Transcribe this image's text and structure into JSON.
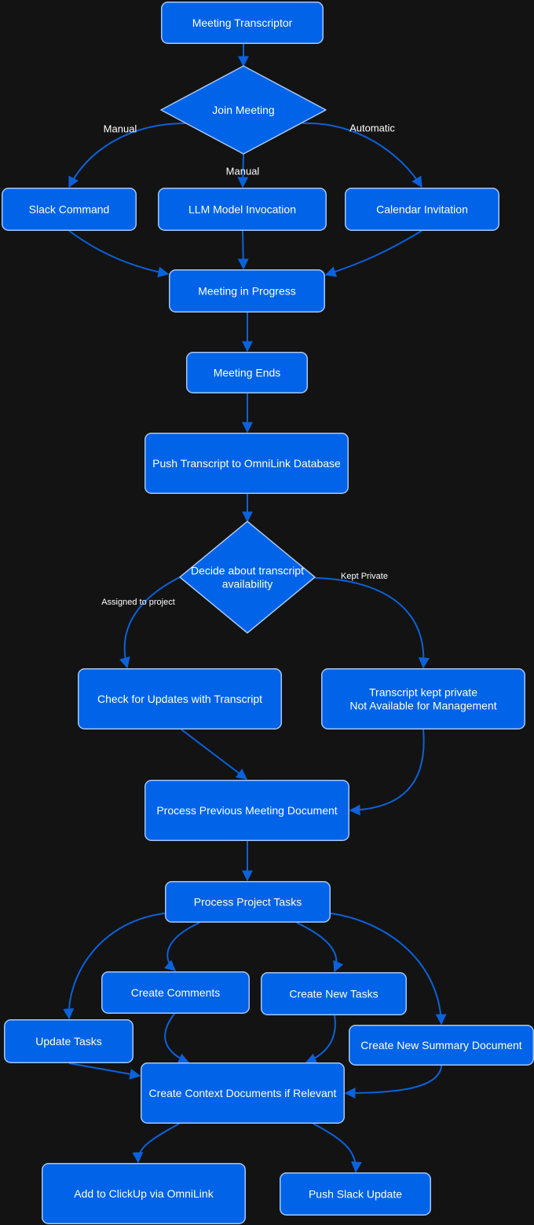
{
  "diagram": {
    "type": "flowchart",
    "colors": {
      "background": "#131313",
      "node_fill": "#0063e8",
      "node_stroke": "#a8c6f2",
      "edge": "#0a62dc",
      "text": "#ffffff"
    },
    "nodes": [
      {
        "id": "meeting_transcriptor",
        "shape": "rect",
        "label": [
          "Meeting Transcriptor"
        ]
      },
      {
        "id": "join_meeting",
        "shape": "diamond",
        "label": [
          "Join Meeting"
        ]
      },
      {
        "id": "slack_command",
        "shape": "rect",
        "label": [
          "Slack Command"
        ]
      },
      {
        "id": "llm_invocation",
        "shape": "rect",
        "label": [
          "LLM Model Invocation"
        ]
      },
      {
        "id": "calendar_invitation",
        "shape": "rect",
        "label": [
          "Calendar Invitation"
        ]
      },
      {
        "id": "meeting_in_progress",
        "shape": "rect",
        "label": [
          "Meeting in Progress"
        ]
      },
      {
        "id": "meeting_ends",
        "shape": "rect",
        "label": [
          "Meeting Ends"
        ]
      },
      {
        "id": "push_transcript",
        "shape": "rect",
        "label": [
          "Push Transcript to OmniLink Database"
        ]
      },
      {
        "id": "decide_availability",
        "shape": "diamond",
        "label": [
          "Decide about transcript",
          "availability"
        ]
      },
      {
        "id": "check_updates",
        "shape": "rect",
        "label": [
          "Check for Updates with Transcript"
        ]
      },
      {
        "id": "kept_private",
        "shape": "rect",
        "label": [
          "Transcript kept private",
          "Not Available for Management"
        ]
      },
      {
        "id": "process_prev_doc",
        "shape": "rect",
        "label": [
          "Process Previous Meeting Document"
        ]
      },
      {
        "id": "process_tasks",
        "shape": "rect",
        "label": [
          "Process Project Tasks"
        ]
      },
      {
        "id": "create_comments",
        "shape": "rect",
        "label": [
          "Create Comments"
        ]
      },
      {
        "id": "create_new_tasks",
        "shape": "rect",
        "label": [
          "Create New Tasks"
        ]
      },
      {
        "id": "update_tasks",
        "shape": "rect",
        "label": [
          "Update Tasks"
        ]
      },
      {
        "id": "create_summary",
        "shape": "rect",
        "label": [
          "Create New Summary Document"
        ]
      },
      {
        "id": "create_context",
        "shape": "rect",
        "label": [
          "Create Context Documents if Relevant"
        ]
      },
      {
        "id": "add_clickup",
        "shape": "rect",
        "label": [
          "Add to ClickUp via OmniLink"
        ]
      },
      {
        "id": "push_slack",
        "shape": "rect",
        "label": [
          "Push Slack Update"
        ]
      }
    ],
    "edges": [
      {
        "from": "meeting_transcriptor",
        "to": "join_meeting",
        "label": ""
      },
      {
        "from": "join_meeting",
        "to": "slack_command",
        "label": "Manual"
      },
      {
        "from": "join_meeting",
        "to": "llm_invocation",
        "label": "Manual"
      },
      {
        "from": "join_meeting",
        "to": "calendar_invitation",
        "label": "Automatic"
      },
      {
        "from": "slack_command",
        "to": "meeting_in_progress",
        "label": ""
      },
      {
        "from": "llm_invocation",
        "to": "meeting_in_progress",
        "label": ""
      },
      {
        "from": "calendar_invitation",
        "to": "meeting_in_progress",
        "label": ""
      },
      {
        "from": "meeting_in_progress",
        "to": "meeting_ends",
        "label": ""
      },
      {
        "from": "meeting_ends",
        "to": "push_transcript",
        "label": ""
      },
      {
        "from": "push_transcript",
        "to": "decide_availability",
        "label": ""
      },
      {
        "from": "decide_availability",
        "to": "check_updates",
        "label": "Assigned to project"
      },
      {
        "from": "decide_availability",
        "to": "kept_private",
        "label": "Kept Private"
      },
      {
        "from": "check_updates",
        "to": "process_prev_doc",
        "label": ""
      },
      {
        "from": "kept_private",
        "to": "process_prev_doc",
        "label": ""
      },
      {
        "from": "process_prev_doc",
        "to": "process_tasks",
        "label": ""
      },
      {
        "from": "process_tasks",
        "to": "update_tasks",
        "label": ""
      },
      {
        "from": "process_tasks",
        "to": "create_comments",
        "label": ""
      },
      {
        "from": "process_tasks",
        "to": "create_new_tasks",
        "label": ""
      },
      {
        "from": "process_tasks",
        "to": "create_summary",
        "label": ""
      },
      {
        "from": "update_tasks",
        "to": "create_context",
        "label": ""
      },
      {
        "from": "create_comments",
        "to": "create_context",
        "label": ""
      },
      {
        "from": "create_new_tasks",
        "to": "create_context",
        "label": ""
      },
      {
        "from": "create_summary",
        "to": "create_context",
        "label": ""
      },
      {
        "from": "create_context",
        "to": "add_clickup",
        "label": ""
      },
      {
        "from": "create_context",
        "to": "push_slack",
        "label": ""
      }
    ]
  }
}
